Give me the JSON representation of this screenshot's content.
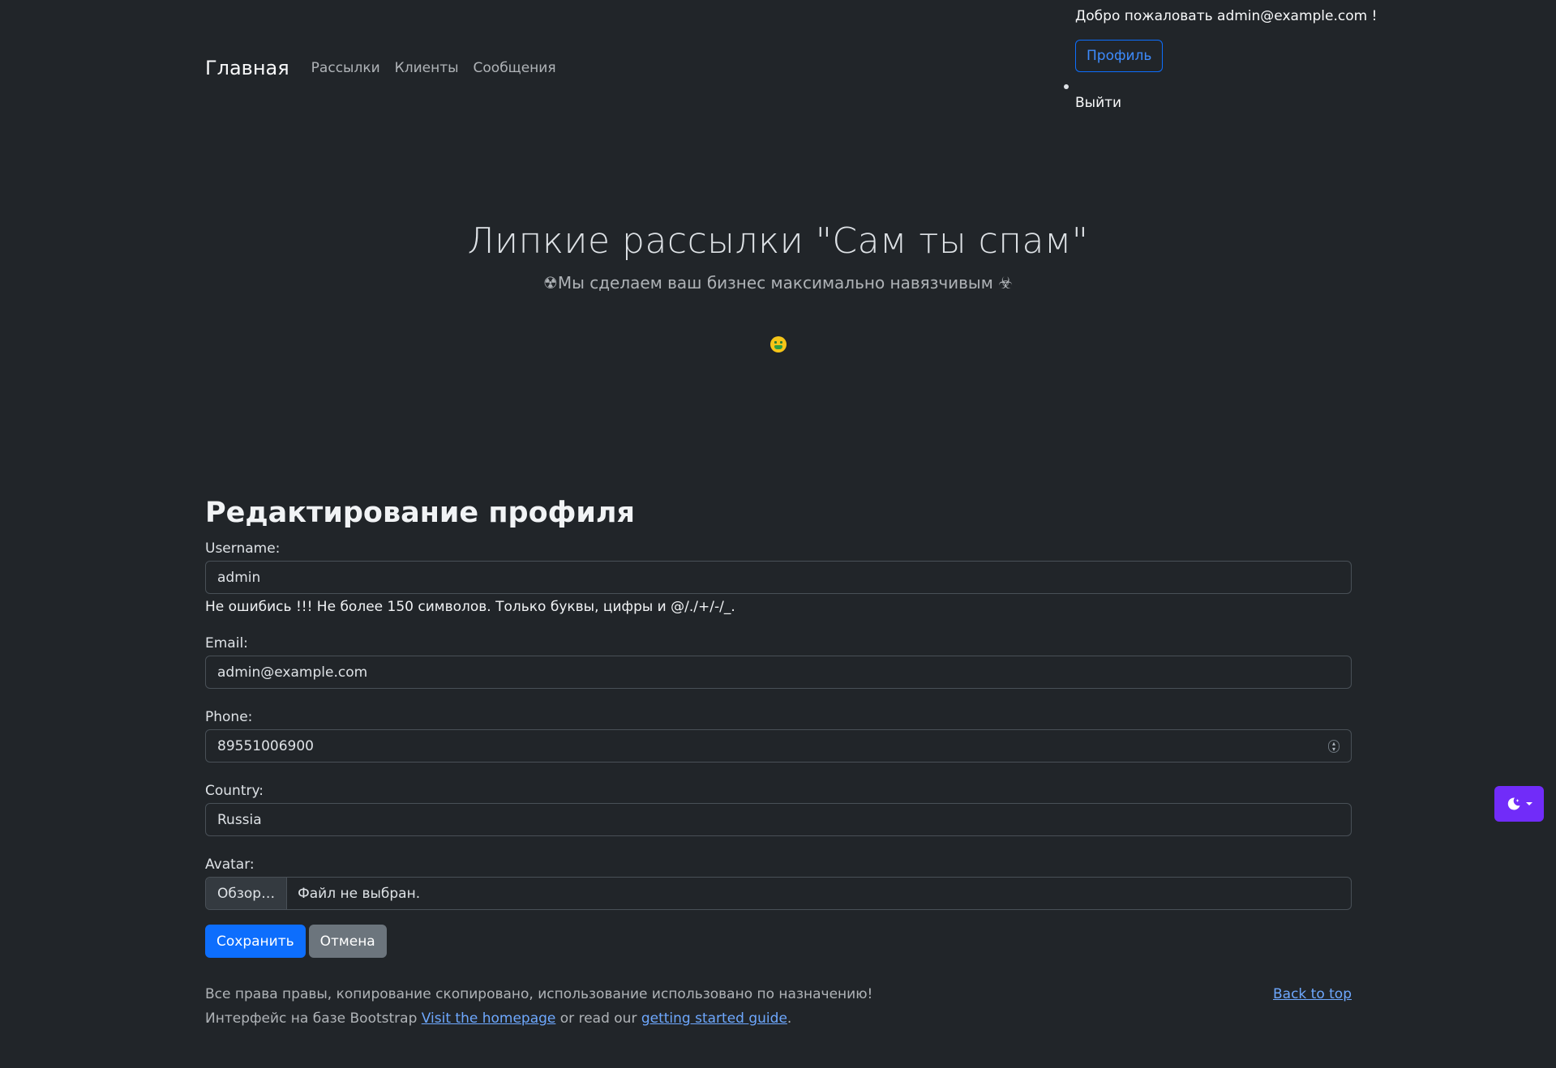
{
  "nav": {
    "brand": "Главная",
    "links": [
      "Рассылки",
      "Клиенты",
      "Сообщения"
    ]
  },
  "user": {
    "welcome": "Добро пожаловать admin@example.com !",
    "profile_label": "Профиль",
    "logout_label": "Выйти"
  },
  "hero": {
    "title": "Липкие рассылки \"Сам ты спам\"",
    "subtitle": "☢Мы сделаем ваш бизнес максимально навязчивым ☣",
    "emoji_icon": "money-mouth-face-icon"
  },
  "form": {
    "title": "Редактирование профиля",
    "username": {
      "label": "Username:",
      "value": "admin",
      "help": "Не ошибись !!! Не более 150 символов. Только буквы, цифры и @/./+/-/_."
    },
    "email": {
      "label": "Email:",
      "value": "admin@example.com"
    },
    "phone": {
      "label": "Phone:",
      "value": "89551006900"
    },
    "country": {
      "label": "Country:",
      "value": "Russia"
    },
    "avatar": {
      "label": "Avatar:",
      "browse_label": "Обзор…",
      "file_status": "Файл не выбран."
    },
    "save_label": "Сохранить",
    "cancel_label": "Отмена"
  },
  "footer": {
    "copyright": "Все права правы, копирование скопировано, использование использовано по назначению!",
    "bootstrap_prefix": "Интерфейс на базе Bootstrap",
    "homepage_link": "Visit the homepage",
    "middle_text": "or read our",
    "guide_link": "getting started guide",
    "back_to_top": "Back to top"
  },
  "theme": {
    "icon": "moon-stars-icon",
    "accent": "#712cf9"
  }
}
